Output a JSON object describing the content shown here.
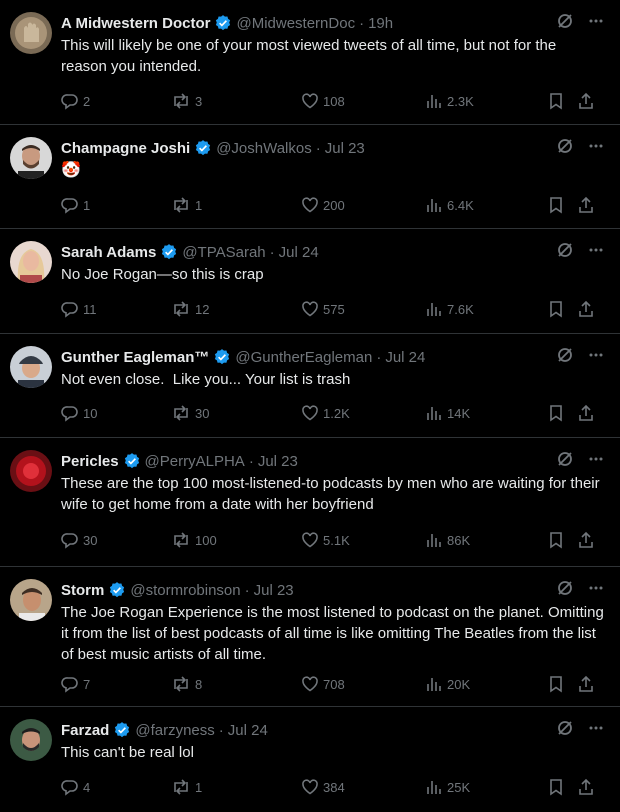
{
  "tweets": [
    {
      "name": "A Midwestern Doctor",
      "handle": "@MidwesternDoc",
      "time": "19h",
      "text": "This will likely be one of your most viewed tweets of all time, but not for the reason you intended.",
      "replies": "2",
      "retweets": "3",
      "likes": "108",
      "views": "2.3K"
    },
    {
      "name": "Champagne Joshi",
      "handle": "@JoshWalkos",
      "time": "Jul 23",
      "text": "🤡",
      "replies": "1",
      "retweets": "1",
      "likes": "200",
      "views": "6.4K"
    },
    {
      "name": "Sarah Adams",
      "handle": "@TPASarah",
      "time": "Jul 24",
      "text": "No Joe Rogan—so this is crap",
      "replies": "11",
      "retweets": "12",
      "likes": "575",
      "views": "7.6K"
    },
    {
      "name": "Gunther Eagleman™",
      "handle": "@GuntherEagleman",
      "time": "Jul 24",
      "text": "Not even close.  Like you... Your list is trash",
      "replies": "10",
      "retweets": "30",
      "likes": "1.2K",
      "views": "14K"
    },
    {
      "name": "Pericles",
      "handle": "@PerryALPHA",
      "time": "Jul 23",
      "text": "These are the top 100 most-listened-to podcasts by men who are waiting for their wife to get home from a date with her boyfriend",
      "replies": "30",
      "retweets": "100",
      "likes": "5.1K",
      "views": "86K"
    },
    {
      "name": "Storm",
      "handle": "@stormrobinson",
      "time": "Jul 23",
      "text": "The Joe Rogan Experience is the most listened to podcast on the planet. Omitting it from the list of best podcasts of all time is like omitting The Beatles from the list of best music artists of all time.",
      "replies": "7",
      "retweets": "8",
      "likes": "708",
      "views": "20K"
    },
    {
      "name": "Farzad",
      "handle": "@farzyness",
      "time": "Jul 24",
      "text": "This can't be real lol",
      "replies": "4",
      "retweets": "1",
      "likes": "384",
      "views": "25K"
    }
  ],
  "meta": {
    "dot": "·",
    "icons": [
      "verified-badge-icon",
      "grok-icon",
      "more-icon",
      "reply-icon",
      "retweet-icon",
      "like-icon",
      "views-icon",
      "bookmark-icon",
      "share-icon"
    ],
    "colors": {
      "background": "#000000",
      "text": "#e7e9ea",
      "muted": "#71767b",
      "verified": "#1d9bf0",
      "divider": "#2f3336"
    }
  }
}
